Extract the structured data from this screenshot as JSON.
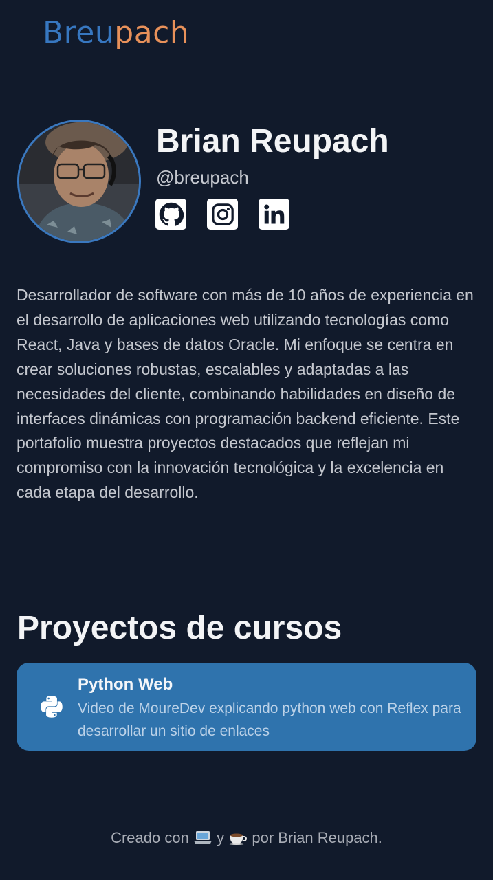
{
  "header": {
    "logo_part1": "Breu",
    "logo_part2": "pach"
  },
  "profile": {
    "name": "Brian Reupach",
    "handle": "@breupach",
    "socials": [
      {
        "icon": "github-icon"
      },
      {
        "icon": "instagram-icon"
      },
      {
        "icon": "linkedin-icon"
      }
    ]
  },
  "bio": "Desarrollador de software con más de 10 años de experiencia en el desarrollo de aplicaciones web utilizando tecnologías como React, Java y bases de datos Oracle. Mi enfoque se centra en crear soluciones robustas, escalables y adaptadas a las necesidades del cliente, combinando habilidades en diseño de interfaces dinámicas con programación backend eficiente. Este portafolio muestra proyectos destacados que reflejan mi compromiso con la innovación tecnológica y la excelencia en cada etapa del desarrollo.",
  "courses": {
    "title": "Proyectos de cursos",
    "items": [
      {
        "icon": "python-icon",
        "title": "Python Web",
        "description": "Video de MoureDev explicando python web con Reflex para desarrollar un sitio de enlaces"
      }
    ]
  },
  "footer": {
    "prefix": "Creado con",
    "mid": "y",
    "suffix": "por Brian Reupach.",
    "icons": [
      "laptop-icon",
      "coffee-icon"
    ]
  },
  "colors": {
    "background": "#111a2b",
    "logo_blue": "#3777c0",
    "logo_orange": "#e8915a",
    "card": "#2f73ad"
  }
}
